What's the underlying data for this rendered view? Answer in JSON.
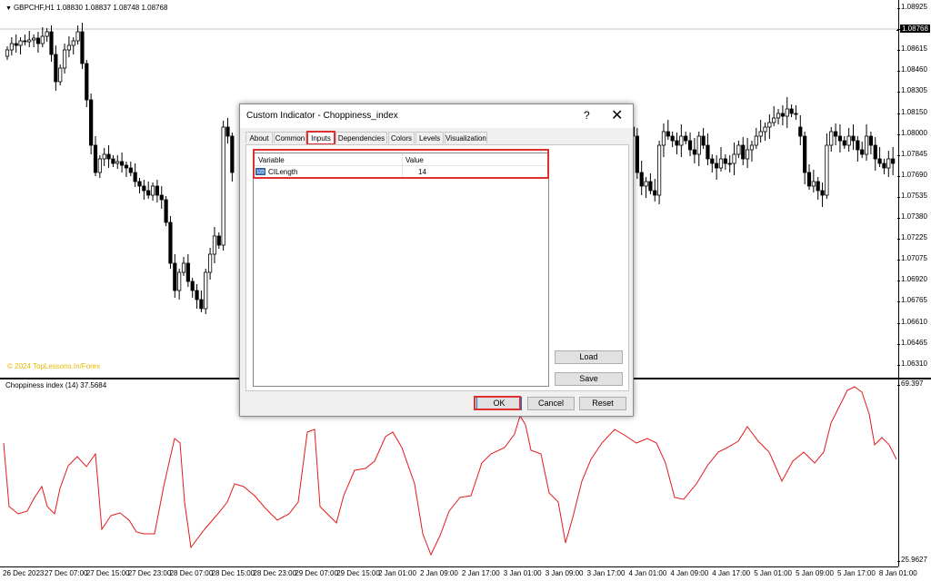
{
  "chart": {
    "title": "GBPCHF,H1  1.08830 1.08837 1.08748 1.08768",
    "copyright": "© 2024 TopLessons.In/Forex",
    "price_ticks": [
      "1.08925",
      "1.08768",
      "1.08615",
      "1.08460",
      "1.08305",
      "1.08150",
      "1.08000",
      "1.07845",
      "1.07690",
      "1.07535",
      "1.07380",
      "1.07225",
      "1.07075",
      "1.06920",
      "1.06765",
      "1.06610",
      "1.06465",
      "1.06310"
    ],
    "current_price": "1.08768",
    "indicator_title": "Choppiness index (14) 37.5684",
    "indicator_ticks": [
      "69.397",
      "25.9627"
    ],
    "time_ticks": [
      "26 Dec 2023",
      "27 Dec 07:00",
      "27 Dec 15:00",
      "27 Dec 23:00",
      "28 Dec 07:00",
      "28 Dec 15:00",
      "28 Dec 23:00",
      "29 Dec 07:00",
      "29 Dec 15:00",
      "2 Jan 01:00",
      "2 Jan 09:00",
      "2 Jan 17:00",
      "3 Jan 01:00",
      "3 Jan 09:00",
      "3 Jan 17:00",
      "4 Jan 01:00",
      "4 Jan 09:00",
      "4 Jan 17:00",
      "5 Jan 01:00",
      "5 Jan 09:00",
      "5 Jan 17:00",
      "8 Jan 01:00"
    ],
    "line_color": "#e31a1c"
  },
  "dialog": {
    "title": "Custom Indicator - Choppiness_index",
    "help": "?",
    "close": "✕",
    "tabs": [
      "About",
      "Common",
      "Inputs",
      "Dependencies",
      "Colors",
      "Levels",
      "Visualization"
    ],
    "active_tab": "Inputs",
    "columns": {
      "variable": "Variable",
      "value": "Value"
    },
    "row": {
      "icon": "123",
      "variable": "CILength",
      "value": "14"
    },
    "buttons": {
      "load": "Load",
      "save": "Save",
      "ok": "OK",
      "cancel": "Cancel",
      "reset": "Reset"
    },
    "highlight_color": "#e03131"
  }
}
